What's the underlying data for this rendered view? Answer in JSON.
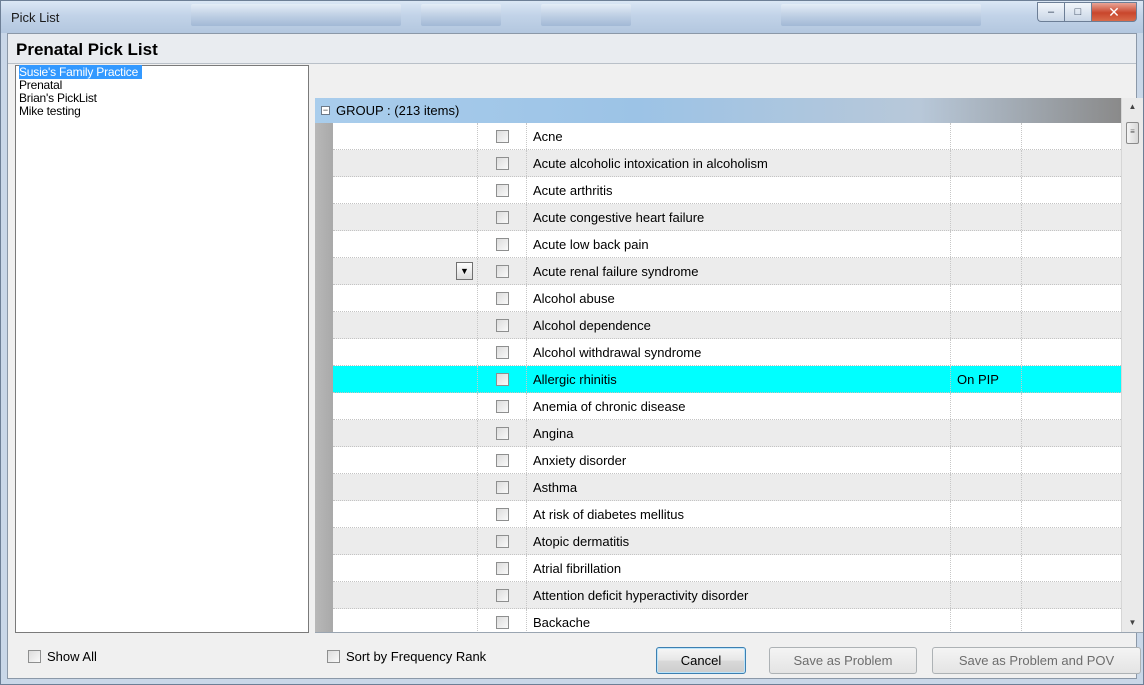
{
  "window": {
    "title": "Pick List",
    "minimize_glyph": "–",
    "maximize_glyph": "□",
    "close_glyph": "✕"
  },
  "page_title": "Prenatal Pick List",
  "pick_lists": [
    {
      "label": "Susie's Family Practice",
      "selected": true
    },
    {
      "label": "Prenatal",
      "selected": false
    },
    {
      "label": "Brian's PickList",
      "selected": false
    },
    {
      "label": "Mike testing",
      "selected": false
    }
  ],
  "show_all_label": "Show All",
  "grid": {
    "group_label": "GROUP :  (213 items)",
    "expander_glyph": "−",
    "dropdown_glyph": "▼",
    "rows": [
      {
        "text": "Acne",
        "status": ""
      },
      {
        "text": "Acute alcoholic intoxication in alcoholism",
        "status": ""
      },
      {
        "text": "Acute arthritis",
        "status": ""
      },
      {
        "text": "Acute congestive heart failure",
        "status": ""
      },
      {
        "text": "Acute low back pain",
        "status": ""
      },
      {
        "text": "Acute renal failure syndrome",
        "status": "",
        "has_dropdown": true
      },
      {
        "text": "Alcohol abuse",
        "status": ""
      },
      {
        "text": "Alcohol dependence",
        "status": ""
      },
      {
        "text": "Alcohol withdrawal syndrome",
        "status": ""
      },
      {
        "text": "Allergic rhinitis",
        "status": "On PIP",
        "highlighted": true
      },
      {
        "text": "Anemia of chronic disease",
        "status": ""
      },
      {
        "text": "Angina",
        "status": ""
      },
      {
        "text": "Anxiety disorder",
        "status": ""
      },
      {
        "text": "Asthma",
        "status": ""
      },
      {
        "text": "At risk of diabetes mellitus",
        "status": ""
      },
      {
        "text": "Atopic dermatitis",
        "status": ""
      },
      {
        "text": "Atrial fibrillation",
        "status": ""
      },
      {
        "text": "Attention deficit hyperactivity disorder",
        "status": ""
      },
      {
        "text": "Backache",
        "status": ""
      }
    ],
    "scroll_up_glyph": "▲",
    "scroll_down_glyph": "▼",
    "thumb_glyph": "≡"
  },
  "footer": {
    "sort_label": "Sort by Frequency Rank",
    "cancel_label": "Cancel",
    "save_problem_label": "Save as Problem",
    "save_problem_pov_label": "Save as Problem and POV"
  },
  "colors": {
    "selection": "#3399ff",
    "highlight_row": "#00ffff",
    "alt_row": "#ececec"
  }
}
